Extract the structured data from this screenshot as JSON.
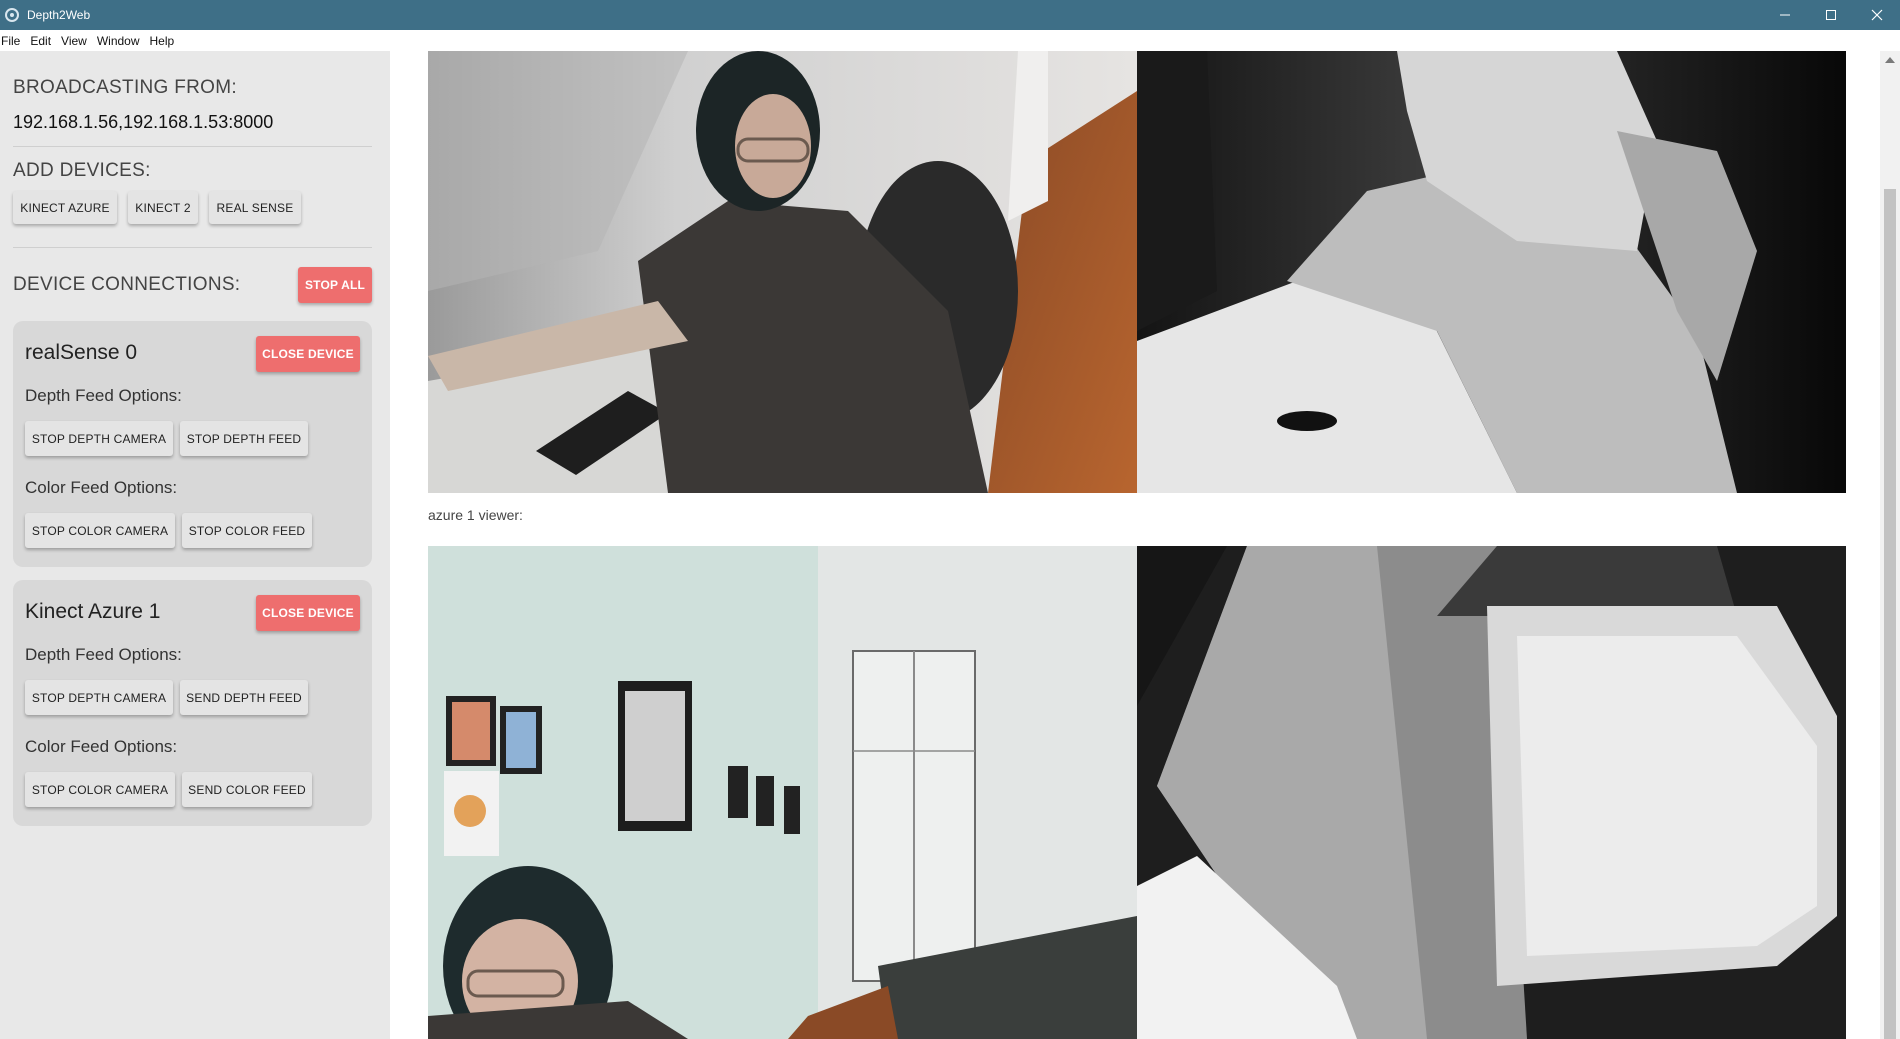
{
  "window": {
    "title": "Depth2Web",
    "controls": [
      "minimize-icon",
      "maximize-icon",
      "close-icon"
    ]
  },
  "menu": [
    "File",
    "Edit",
    "View",
    "Window",
    "Help"
  ],
  "sidebar": {
    "broadcast_heading": "BROADCASTING FROM:",
    "broadcast_address": "192.168.1.56,192.168.1.53:8000",
    "add_heading": "ADD DEVICES:",
    "add_buttons": [
      "KINECT AZURE",
      "KINECT 2",
      "REAL SENSE"
    ],
    "connections_heading": "DEVICE CONNECTIONS:",
    "stop_all_label": "STOP ALL",
    "devices": [
      {
        "name": "realSense 0",
        "close_label": "CLOSE DEVICE",
        "depth_label": "Depth Feed Options:",
        "depth_camera_button": "STOP DEPTH CAMERA",
        "depth_feed_button": "STOP DEPTH FEED",
        "color_label": "Color Feed Options:",
        "color_camera_button": "STOP COLOR CAMERA",
        "color_feed_button": "STOP COLOR FEED"
      },
      {
        "name": "Kinect Azure 1",
        "close_label": "CLOSE DEVICE",
        "depth_label": "Depth Feed Options:",
        "depth_camera_button": "STOP DEPTH CAMERA",
        "depth_feed_button": "SEND DEPTH FEED",
        "color_label": "Color Feed Options:",
        "color_camera_button": "STOP COLOR CAMERA",
        "color_feed_button": "SEND COLOR FEED"
      }
    ]
  },
  "main": {
    "viewer_label": "azure 1 viewer:"
  },
  "colors": {
    "titlebar": "#3e6f87",
    "sidebar_bg": "#e8e8e8",
    "card_bg": "#d8d8d8",
    "danger_button": "#ee6e6e"
  }
}
